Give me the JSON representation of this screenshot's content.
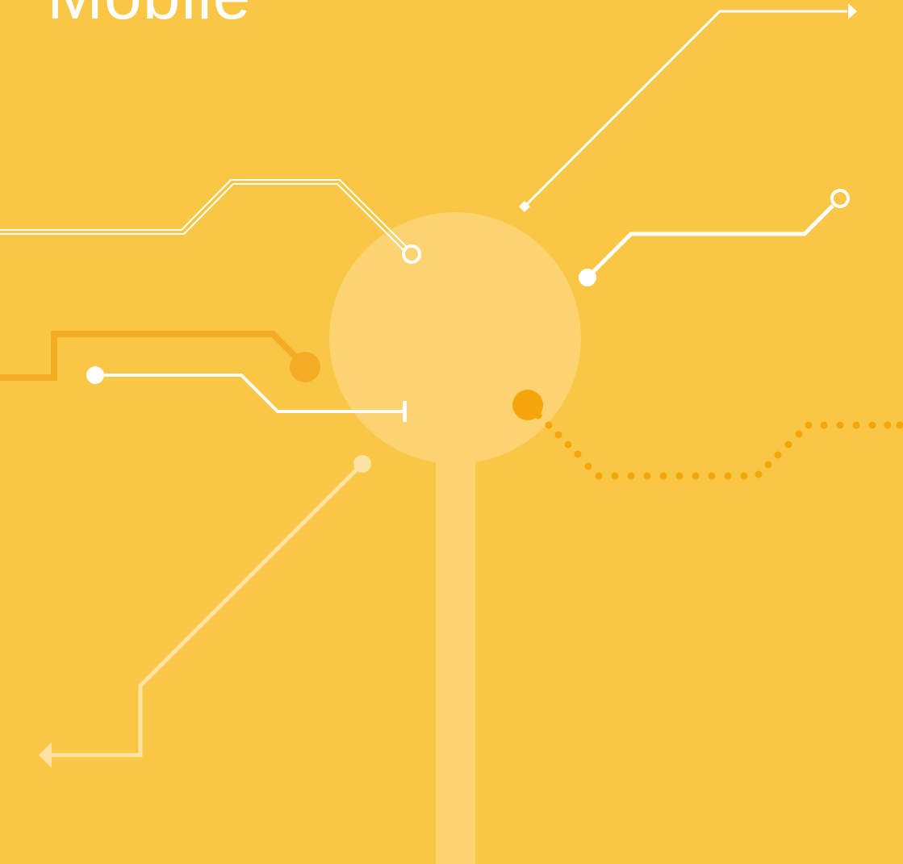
{
  "title": "Mobile",
  "colors": {
    "background": "#f9c745",
    "hub": "#fbd370",
    "white": "#ffffff",
    "pale_line": "#fde3a3",
    "orange": "#f4a60c",
    "dark_orange": "#f5ac25"
  },
  "icons": [
    "arrow-right-icon",
    "arrow-left-icon",
    "diamond-node-icon",
    "ring-node-icon",
    "dot-node-icon",
    "bar-end-icon"
  ]
}
